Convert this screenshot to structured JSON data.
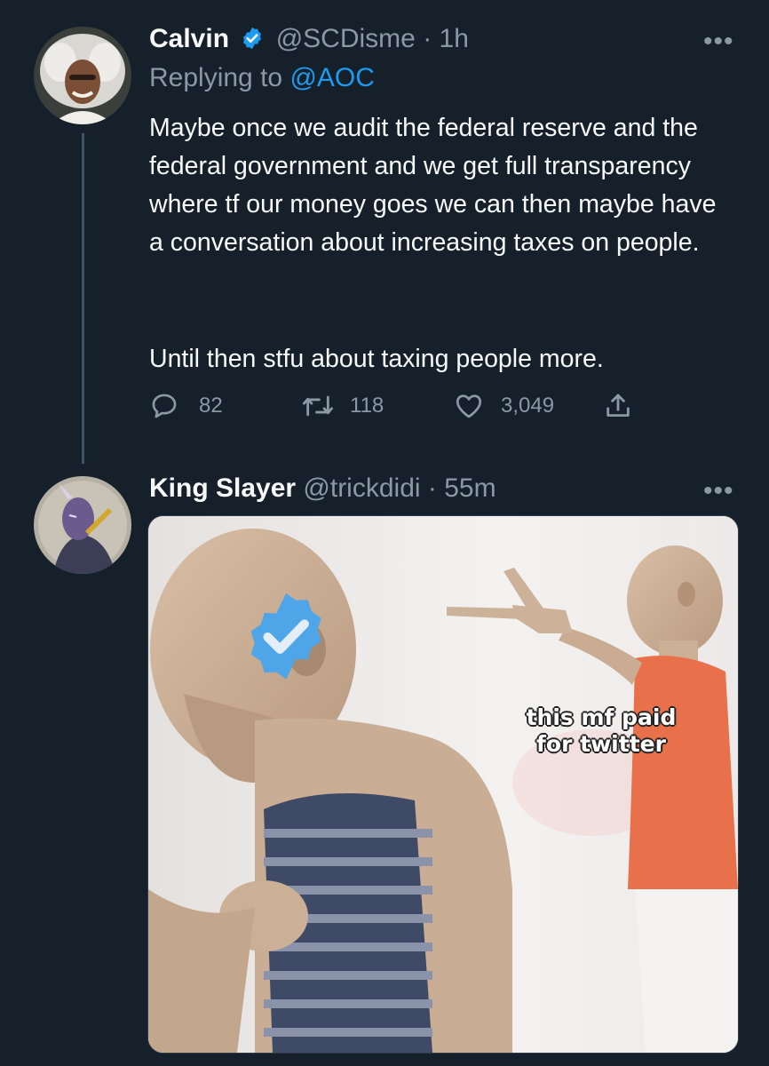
{
  "tweet1": {
    "name": "Calvin",
    "handle": "@SCDisme",
    "time": "· 1h",
    "replying_prefix": "Replying to",
    "replying_to": "@AOC",
    "para1": "Maybe once we audit the federal reserve and the federal government and we get full transparency where tf our money goes we can then maybe have a conversation about increasing taxes on people.",
    "para2": "Until then stfu about taxing people more.",
    "replies": "82",
    "retweets": "118",
    "likes": "3,049",
    "more": "•••"
  },
  "tweet2": {
    "name": "King Slayer",
    "handle": "@trickdidi",
    "time": "· 55m",
    "more": "•••",
    "meme_line1": "this mf paid",
    "meme_line2": "for twitter"
  },
  "colors": {
    "background": "#15202b",
    "accent": "#1d9bf0",
    "muted": "#8b98a5",
    "verified": "#1d9bf0"
  }
}
